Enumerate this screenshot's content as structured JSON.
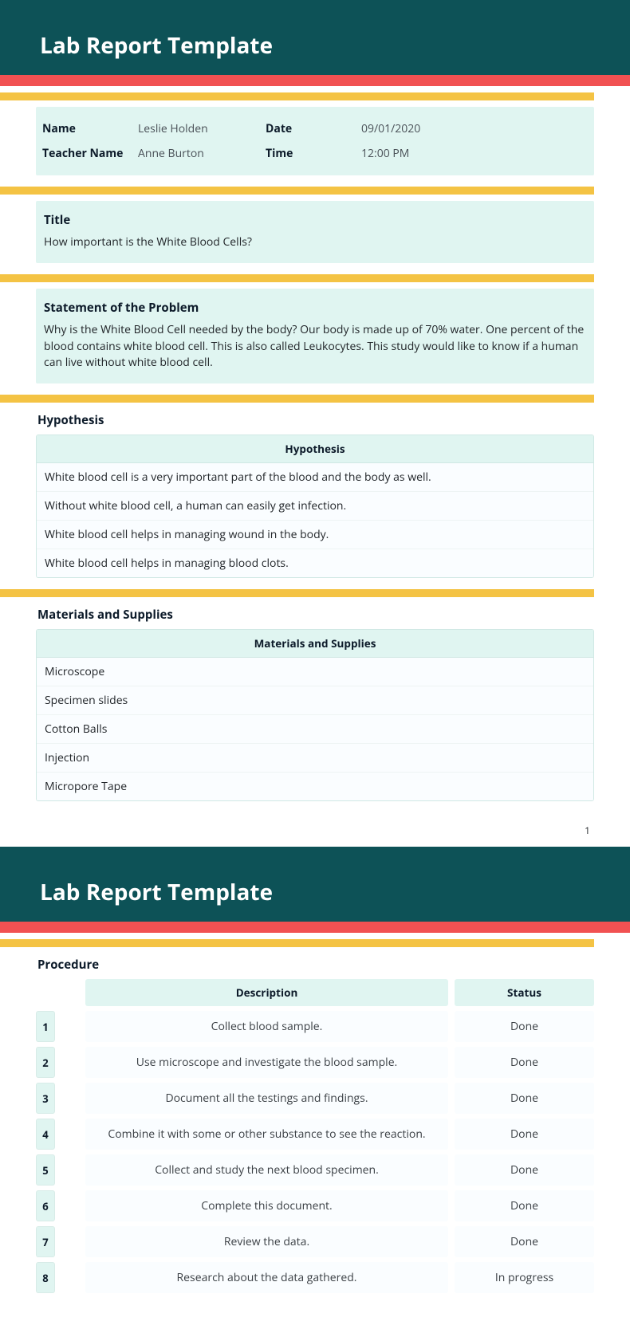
{
  "header": {
    "title": "Lab Report Template"
  },
  "info": {
    "name_label": "Name",
    "name": "Leslie Holden",
    "date_label": "Date",
    "date": "09/01/2020",
    "teacher_label": "Teacher Name",
    "teacher": "Anne Burton",
    "time_label": "Time",
    "time": "12:00 PM"
  },
  "title_section": {
    "label": "Title",
    "text": "How important is the White Blood Cells?"
  },
  "problem": {
    "label": "Statement of the Problem",
    "text": "Why is the White Blood Cell needed by the body? Our body is made up of 70% water. One percent of the blood contains white blood cell. This is also called Leukocytes. This study would like to know if a human can live without white blood cell."
  },
  "hypothesis": {
    "heading": "Hypothesis",
    "col": "Hypothesis",
    "rows": [
      "White blood cell is a very important part of the blood and the body as well.",
      "Without white blood cell, a human can easily get infection.",
      "White blood cell helps in managing wound in the body.",
      "White blood cell helps in managing blood clots."
    ]
  },
  "materials": {
    "heading": "Materials and Supplies",
    "col": "Materials and Supplies",
    "rows": [
      "Microscope",
      "Specimen slides",
      "Cotton Balls",
      "Injection",
      "Micropore Tape"
    ]
  },
  "page1": "1",
  "procedure": {
    "heading": "Procedure",
    "desc_col": "Description",
    "status_col": "Status",
    "rows": [
      {
        "n": "1",
        "desc": "Collect blood sample.",
        "status": "Done"
      },
      {
        "n": "2",
        "desc": "Use microscope and investigate the blood sample.",
        "status": "Done"
      },
      {
        "n": "3",
        "desc": "Document all the testings and findings.",
        "status": "Done"
      },
      {
        "n": "4",
        "desc": "Combine it with some or other substance to see the reaction.",
        "status": "Done"
      },
      {
        "n": "5",
        "desc": "Collect and study the next blood specimen.",
        "status": "Done"
      },
      {
        "n": "6",
        "desc": "Complete this document.",
        "status": "Done"
      },
      {
        "n": "7",
        "desc": "Review the data.",
        "status": "Done"
      },
      {
        "n": "8",
        "desc": "Research about the data gathered.",
        "status": "In progress"
      }
    ]
  }
}
